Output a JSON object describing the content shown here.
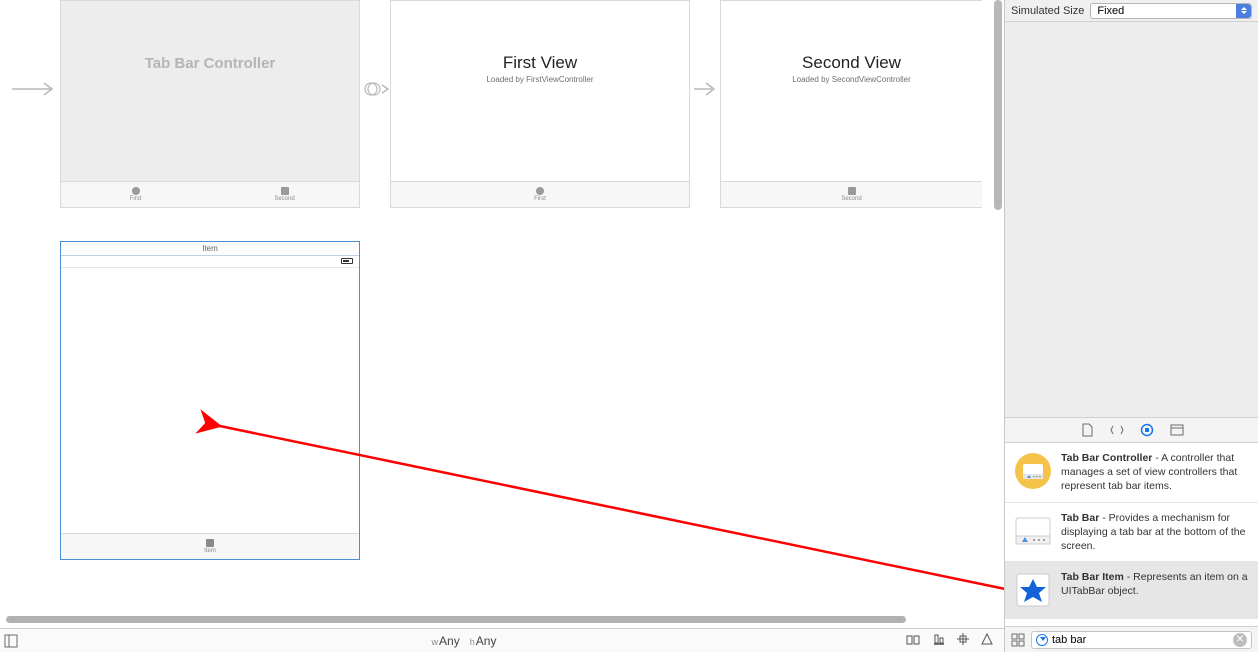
{
  "inspector": {
    "simulated_size_label": "Simulated Size",
    "simulated_size_value": "Fixed"
  },
  "scenes": {
    "tabbar_controller": {
      "title": "Tab Bar Controller",
      "tabs": [
        {
          "label": "First",
          "shape": "circle"
        },
        {
          "label": "Second",
          "shape": "square"
        }
      ]
    },
    "first_view": {
      "title": "First View",
      "subtitle": "Loaded by FirstViewController",
      "tab_label": "First"
    },
    "second_view": {
      "title": "Second View",
      "subtitle": "Loaded by SecondViewController",
      "tab_label": "Second"
    },
    "item_scene": {
      "header": "Item",
      "tab_label": "Item"
    }
  },
  "bottom_bar": {
    "w_prefix": "w",
    "w_value": "Any",
    "h_prefix": "h",
    "h_value": "Any"
  },
  "library": {
    "items": [
      {
        "title": "Tab Bar Controller",
        "desc": " - A controller that manages a set of view controllers that represent tab bar items."
      },
      {
        "title": "Tab Bar",
        "desc": " - Provides a mechanism for displaying a tab bar at the bottom of the screen."
      },
      {
        "title": "Tab Bar Item",
        "desc": " - Represents an item on a UITabBar object."
      }
    ],
    "search_value": "tab bar"
  }
}
